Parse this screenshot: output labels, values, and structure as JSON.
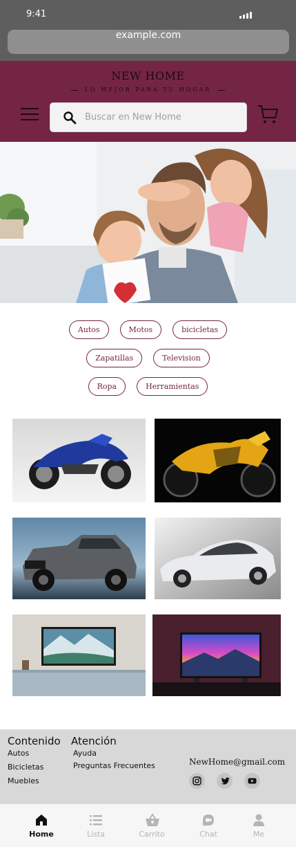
{
  "status_bar": {
    "time": "9:41"
  },
  "browser": {
    "url": "example.com"
  },
  "header": {
    "brand": "NEW HOME",
    "tagline": "LO MEJOR PARA TU HOGAR",
    "search_placeholder": "Buscar en New Home",
    "accent_color": "#742543"
  },
  "categories": {
    "row1": [
      "Autos",
      "Motos",
      "bicicletas"
    ],
    "row2": [
      "Zapatillas",
      "Television"
    ],
    "row3": [
      "Ropa",
      "Herramientas"
    ]
  },
  "footer": {
    "contenido_title": "Contenido",
    "contenido_links": [
      "Autos",
      "Bicicletas",
      "Muebles"
    ],
    "atencion_title": "Atención",
    "atencion_links": [
      "Ayuda",
      "Preguntas Frecuentes"
    ],
    "email": "NewHome@gmail.com",
    "social_icons": [
      "instagram-icon",
      "twitter-icon",
      "youtube-icon"
    ]
  },
  "bottom_nav": {
    "items": [
      {
        "label": "Home",
        "icon": "home-icon",
        "active": true
      },
      {
        "label": "Lista",
        "icon": "list-icon",
        "active": false
      },
      {
        "label": "Carrito",
        "icon": "basket-icon",
        "active": false
      },
      {
        "label": "Chat",
        "icon": "chat-icon",
        "active": false
      },
      {
        "label": "Me",
        "icon": "person-icon",
        "active": false
      }
    ]
  }
}
